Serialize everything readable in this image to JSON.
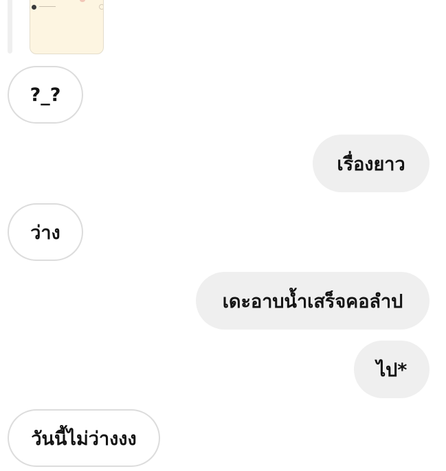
{
  "chat": {
    "shared_post": {
      "thumbnail_icon": "image-thumbnail"
    },
    "messages": [
      {
        "side": "received",
        "text": "?_?"
      },
      {
        "side": "sent",
        "text": "เรื่องยาว"
      },
      {
        "side": "received",
        "text": "ว่าง"
      },
      {
        "side": "sent",
        "text": "เดะอาบน้ำเสร็จคอลำป"
      },
      {
        "side": "sent",
        "text": "ไป*"
      },
      {
        "side": "received",
        "text": "วันนี้ไม่ว่างงง"
      }
    ]
  },
  "colors": {
    "received_bubble_bg": "#ffffff",
    "received_bubble_border": "#dcdcdc",
    "sent_bubble_bg": "#efefef",
    "text": "#141414",
    "thumbnail_bg": "#fdf5e1"
  }
}
